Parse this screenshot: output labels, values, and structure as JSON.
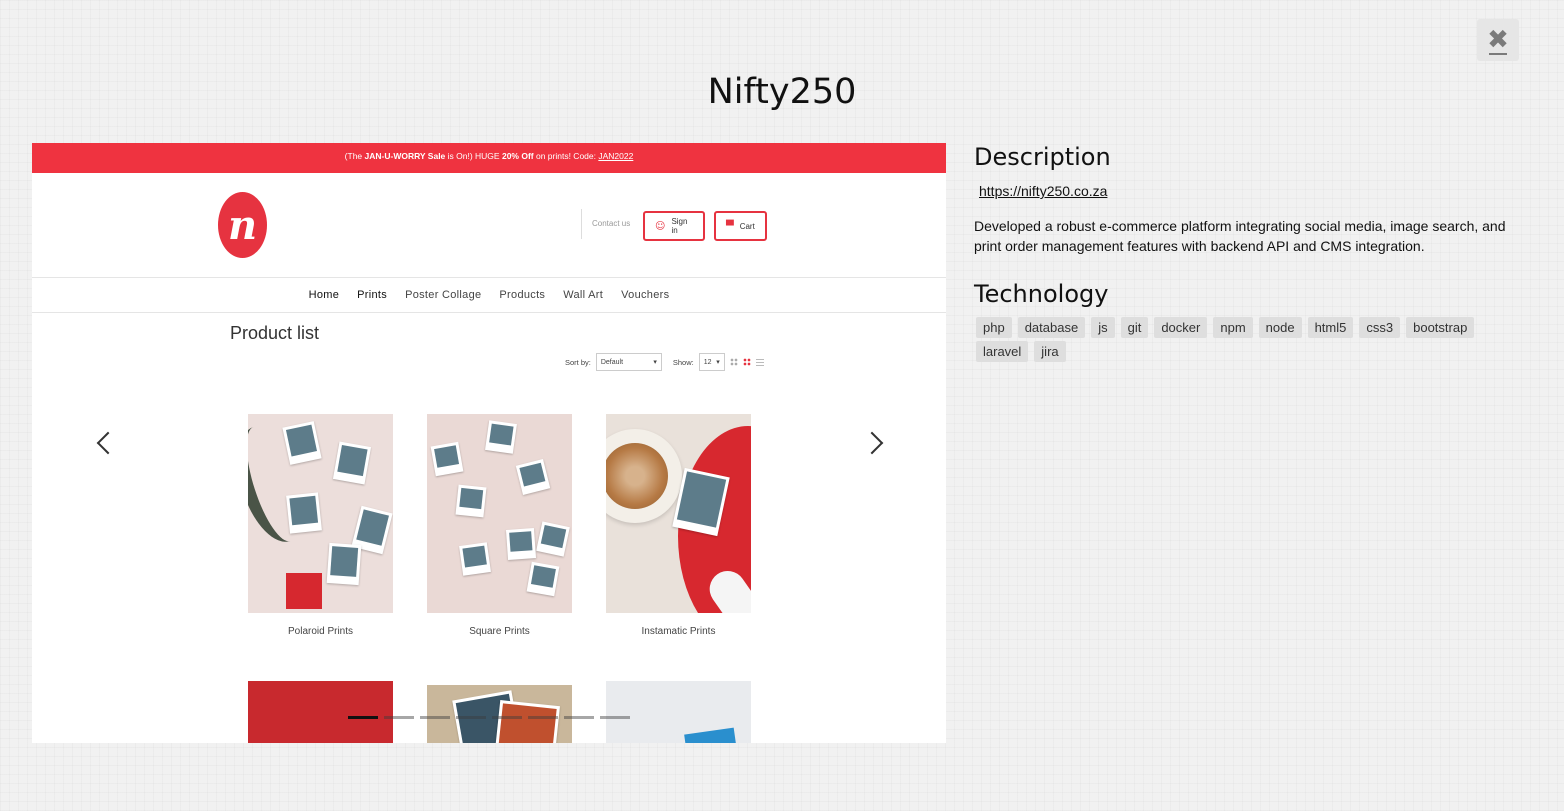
{
  "modal": {
    "title": "Nifty250",
    "close_icon": "close-icon"
  },
  "screenshot": {
    "promo": {
      "pre": "(The ",
      "sale_name": "JAN-U-WORRY Sale",
      "mid": " is On!) HUGE ",
      "discount": "20% Off",
      "post": " on prints! Code: ",
      "code": "JAN2022"
    },
    "logo_text": "n",
    "contact": "Contact us",
    "signin": "Sign in",
    "cart": "Cart",
    "nav": [
      "Home",
      "Prints",
      "Poster Collage",
      "Products",
      "Wall Art",
      "Vouchers"
    ],
    "heading": "Product list",
    "sort_label": "Sort by:",
    "sort_value": "Default",
    "show_label": "Show:",
    "show_value": "12",
    "products": [
      "Polaroid Prints",
      "Square Prints",
      "Instamatic Prints"
    ]
  },
  "carousel": {
    "slide_count": 8,
    "active_slide": 1
  },
  "info": {
    "description_title": "Description",
    "url": "https://nifty250.co.za",
    "description": "Developed a robust e-commerce platform integrating social media, image search, and print order management features with backend API and CMS integration.",
    "technology_title": "Technology",
    "technologies": [
      "php",
      "database",
      "js",
      "git",
      "docker",
      "npm",
      "node",
      "html5",
      "css3",
      "bootstrap",
      "laravel",
      "jira"
    ]
  },
  "colors": {
    "brand_red": "#ef3340",
    "background": "#f1f1f1"
  }
}
